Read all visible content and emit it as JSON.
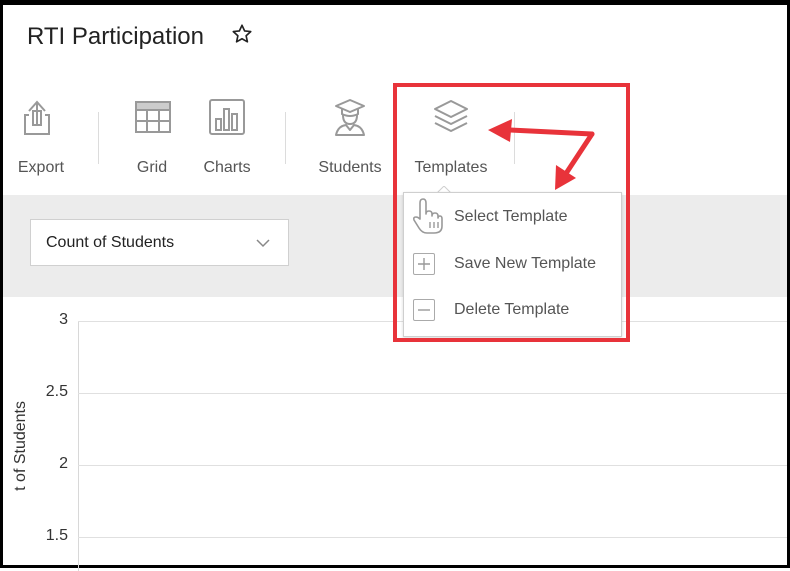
{
  "page": {
    "title": "RTI Participation"
  },
  "icons": {
    "favorite": "star-outline-icon",
    "export": "export-icon",
    "grid": "grid-icon",
    "charts": "bar-chart-icon",
    "students": "student-icon",
    "templates": "layers-icon"
  },
  "toolbar": {
    "export_label": "Export",
    "grid_label": "Grid",
    "charts_label": "Charts",
    "students_label": "Students",
    "templates_label": "Templates"
  },
  "filter": {
    "selected": "Count of Students"
  },
  "templates_menu": {
    "items": [
      {
        "label": "Select Template",
        "icon": "pointer-hand-icon"
      },
      {
        "label": "Save New Template",
        "icon": "plus-icon"
      },
      {
        "label": "Delete Template",
        "icon": "minus-icon"
      }
    ]
  },
  "chart": {
    "y_ticks": [
      "3",
      "2.5",
      "2",
      "1.5"
    ],
    "y_label": "t of Students"
  },
  "annotation": {
    "color": "#e8333a"
  }
}
